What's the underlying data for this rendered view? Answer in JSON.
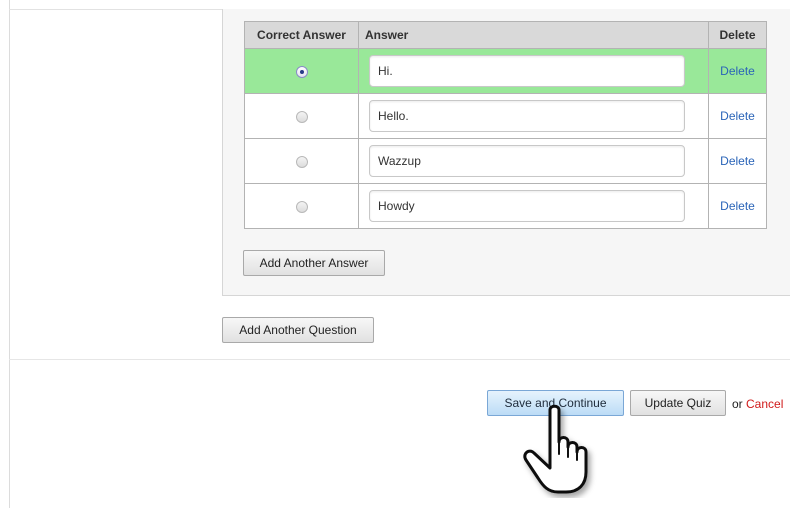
{
  "answers_table": {
    "headers": {
      "correct": "Correct Answer",
      "answer": "Answer",
      "delete": "Delete"
    },
    "rows": [
      {
        "answer": "Hi.",
        "correct": true,
        "delete_label": "Delete"
      },
      {
        "answer": "Hello.",
        "correct": false,
        "delete_label": "Delete"
      },
      {
        "answer": "Wazzup",
        "correct": false,
        "delete_label": "Delete"
      },
      {
        "answer": "Howdy",
        "correct": false,
        "delete_label": "Delete"
      }
    ],
    "selected_row_color": "#99e899"
  },
  "buttons": {
    "add_answer": "Add Another Answer",
    "add_question": "Add Another Question",
    "save_continue": "Save and Continue",
    "update_quiz": "Update Quiz"
  },
  "footer": {
    "or_text": "or",
    "cancel": "Cancel"
  },
  "colors": {
    "link": "#2a64b8",
    "cancel": "#d01b1b"
  },
  "cursor": {
    "icon": "hand-pointer-icon"
  }
}
